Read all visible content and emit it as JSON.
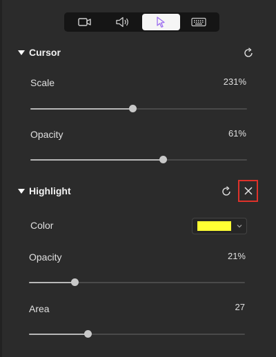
{
  "tabs": [
    {
      "name": "video",
      "icon": "video-camera-icon",
      "active": false
    },
    {
      "name": "audio",
      "icon": "speaker-icon",
      "active": false
    },
    {
      "name": "cursor",
      "icon": "cursor-pointer-icon",
      "active": true
    },
    {
      "name": "keyboard",
      "icon": "keyboard-icon",
      "active": false
    }
  ],
  "cursor": {
    "title": "Cursor",
    "scale": {
      "label": "Scale",
      "value": "231%",
      "level": 0.47
    },
    "opacity": {
      "label": "Opacity",
      "value": "61%",
      "level": 0.61
    }
  },
  "highlight": {
    "title": "Highlight",
    "color": {
      "label": "Color",
      "value": "#ffff33"
    },
    "opacity": {
      "label": "Opacity",
      "value": "21%",
      "level": 0.21
    },
    "area": {
      "label": "Area",
      "value": "27",
      "level": 0.27
    }
  },
  "colors": {
    "background": "#2b2b2b",
    "accent_purple": "#9b6cf0",
    "close_highlight": "#e0322a"
  }
}
